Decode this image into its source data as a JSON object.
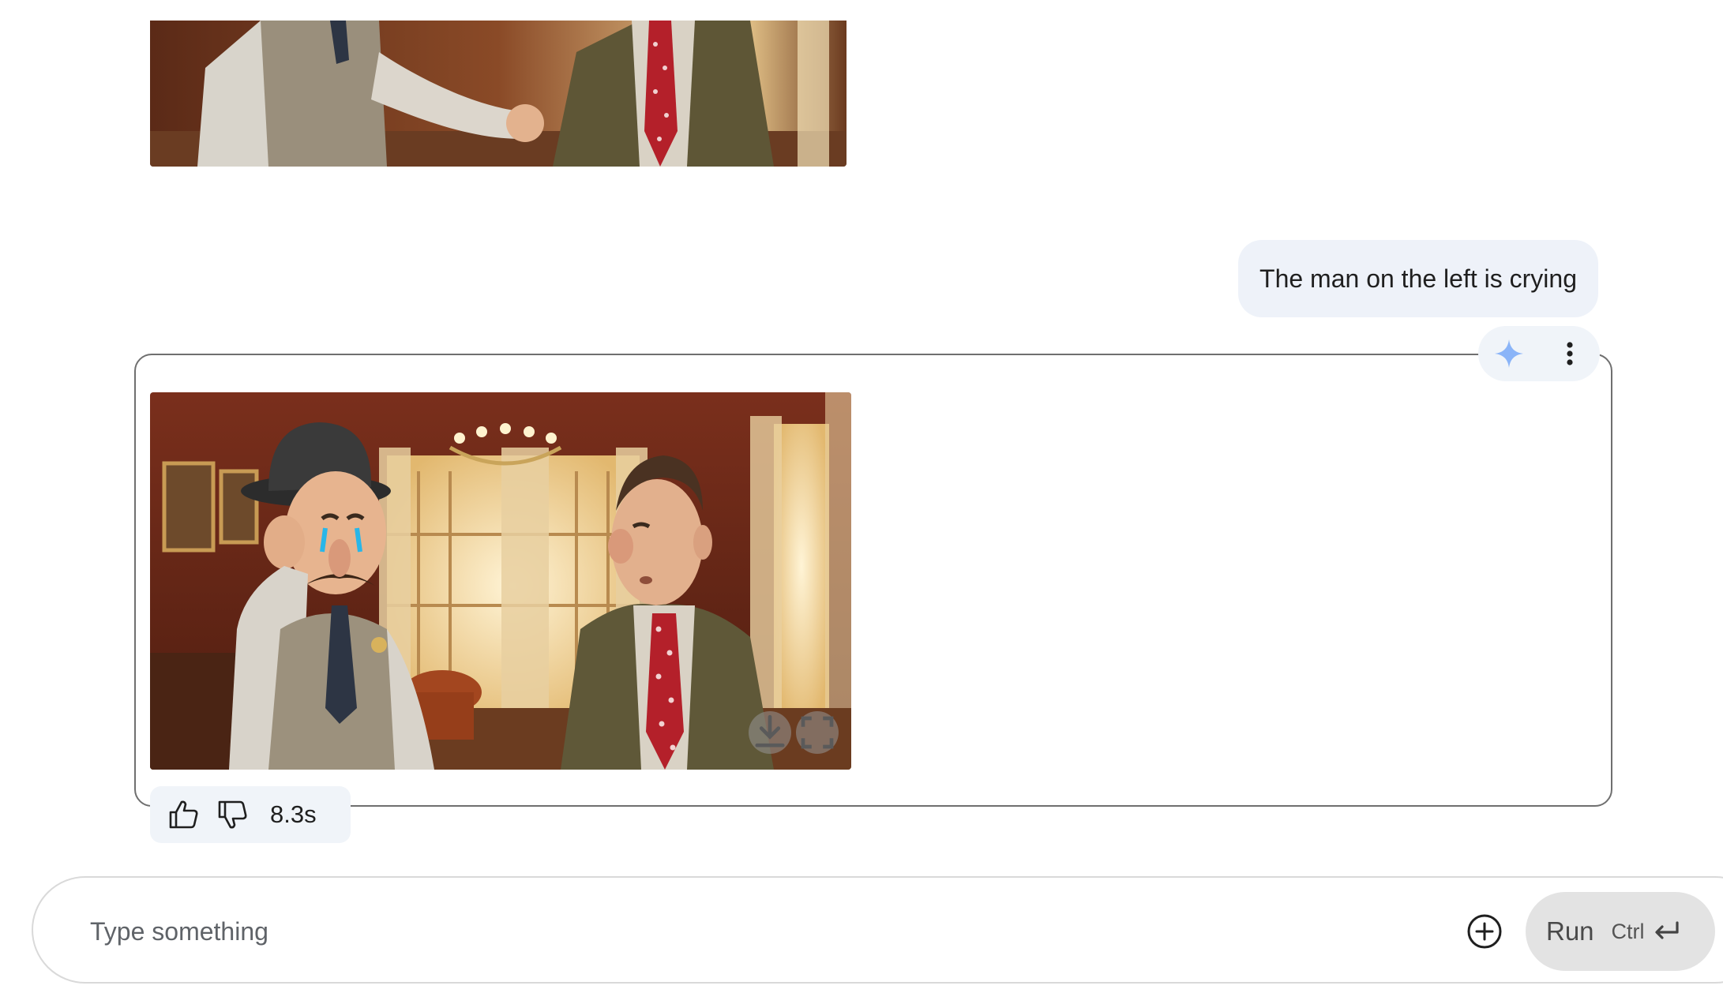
{
  "chat": {
    "user_prompt": "The man on the left is crying",
    "response_time": "8.3s"
  },
  "icons": {
    "sparkle": "sparkle-icon",
    "more": "more-vert-icon",
    "download": "download-icon",
    "fullscreen": "fullscreen-icon",
    "like": "thumb-up-icon",
    "dislike": "thumb-down-icon",
    "add": "add-circle-icon",
    "enter": "enter-icon"
  },
  "composer": {
    "placeholder": "Type something",
    "run_label": "Run",
    "shortcut_label": "Ctrl"
  },
  "colors": {
    "accent": "#8ab4f8",
    "bubble_bg": "#eef2f9",
    "run_bg": "#e3e3e3"
  }
}
